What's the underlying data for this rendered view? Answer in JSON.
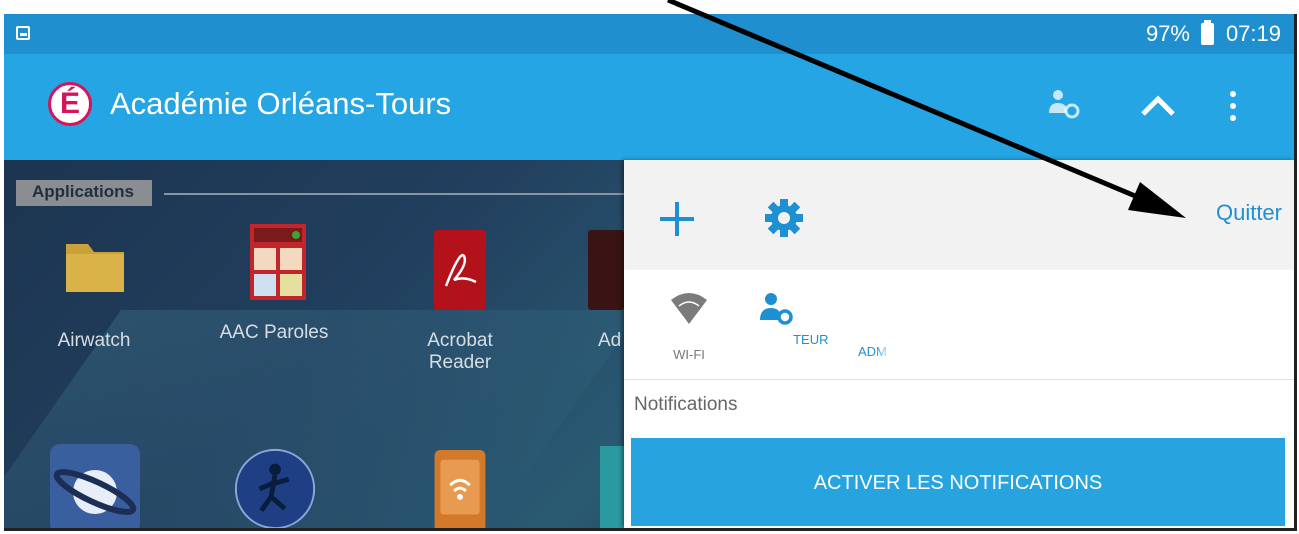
{
  "status_bar": {
    "battery_percent": "97%",
    "time": "07:19"
  },
  "app_bar": {
    "logo_letter": "É",
    "title": "Académie Orléans-Tours",
    "icons": [
      "admin-user-gear-icon",
      "chevron-up-icon",
      "overflow-menu-icon"
    ]
  },
  "launcher": {
    "section_label": "Applications",
    "apps": [
      {
        "label": "Airwatch",
        "icon": "folder-icon"
      },
      {
        "label": "AAC Paroles",
        "icon": "aac-paroles-icon"
      },
      {
        "label": "Acrobat\nReader",
        "icon": "acrobat-reader-icon"
      },
      {
        "label": "Ad",
        "icon": "app-icon"
      }
    ],
    "second_row_icons": [
      "saturn-icon",
      "runner-globe-icon",
      "wifi-device-icon",
      "app-icon"
    ]
  },
  "panel": {
    "quit_label": "Quitter",
    "tiles": [
      {
        "label": "WI-FI",
        "icon": "wifi-icon"
      },
      {
        "label": "TEUR",
        "icon": "user-gear-icon"
      },
      {
        "label": "ADM",
        "icon": ""
      }
    ],
    "notifications_label": "Notifications",
    "notifications_button": "ACTIVER LES NOTIFICATIONS"
  },
  "colors": {
    "status_bar": "#1f8fd0",
    "app_bar": "#25a5e3",
    "accent": "#27a3df",
    "link": "#1e90d2"
  }
}
